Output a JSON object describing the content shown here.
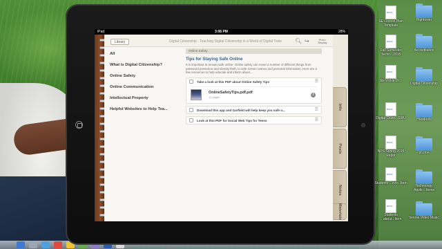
{
  "app": {
    "library_label": "Library",
    "title": "Digital Citizenship - Teaching Digital Citizenship in a World of Digital Tools",
    "print_label": "Print / Display"
  },
  "status_bar": {
    "carrier": "iPad",
    "time": "3:06 PM",
    "battery": "28%"
  },
  "nav": {
    "items": [
      {
        "label": "All"
      },
      {
        "label": "What is Digital Citizenship?"
      },
      {
        "label": "Online Safety"
      },
      {
        "label": "Online Communication"
      },
      {
        "label": "Intellectual Property"
      },
      {
        "label": "Helpful Websites to Help Tea..."
      }
    ]
  },
  "content": {
    "section": "Online Safety",
    "title": "Tips for Staying Safe Online",
    "body": "It is important to remain safe online. Online safety can mean a number of different things from password protection and identity theft, to safe screen names and personal information. Here are a few resources to help educate and inform about...",
    "tasks": [
      {
        "label": "Take a look at this PDF about Online Safety Tips"
      },
      {
        "label": "Download this app and Garfield will help keep you safe o..."
      },
      {
        "label": "Look at this PDF for Social Web Tips for Teens"
      }
    ],
    "attachment": {
      "name": "OnlineSafetyTips.pdf.pdf",
      "pages": "11 pages"
    }
  },
  "tabs": [
    "Info",
    "Posts",
    "Notes",
    "Materials"
  ],
  "desktop_icons": [
    {
      "label": "SE Lesson Plan Template",
      "icon": "doc-icon"
    },
    {
      "label": "Hightower",
      "icon": "folder-icon"
    },
    {
      "label": "Fall Semester Techn...2015",
      "icon": "doc-icon"
    },
    {
      "label": "Accreditation",
      "icon": "folder-icon"
    },
    {
      "label": "SE-Vickie Dr...",
      "icon": "doc-icon"
    },
    {
      "label": "Digital Citizenship",
      "icon": "folder-icon"
    },
    {
      "label": "Digital Citize...SWU",
      "icon": "doc-icon"
    },
    {
      "label": "Handouts",
      "icon": "folder-icon"
    },
    {
      "label": "NPS Spring 2015 Repor",
      "icon": "doc-icon"
    },
    {
      "label": "pLcme",
      "icon": "folder-icon"
    },
    {
      "label": "Students ...evo...Item",
      "icon": "doc-icon"
    },
    {
      "label": "Technology Applic...Items",
      "icon": "folder-icon"
    },
    {
      "label": "Students ...about...Item",
      "icon": "doc-icon"
    },
    {
      "label": "Vennie Video Music",
      "icon": "folder-icon"
    }
  ]
}
